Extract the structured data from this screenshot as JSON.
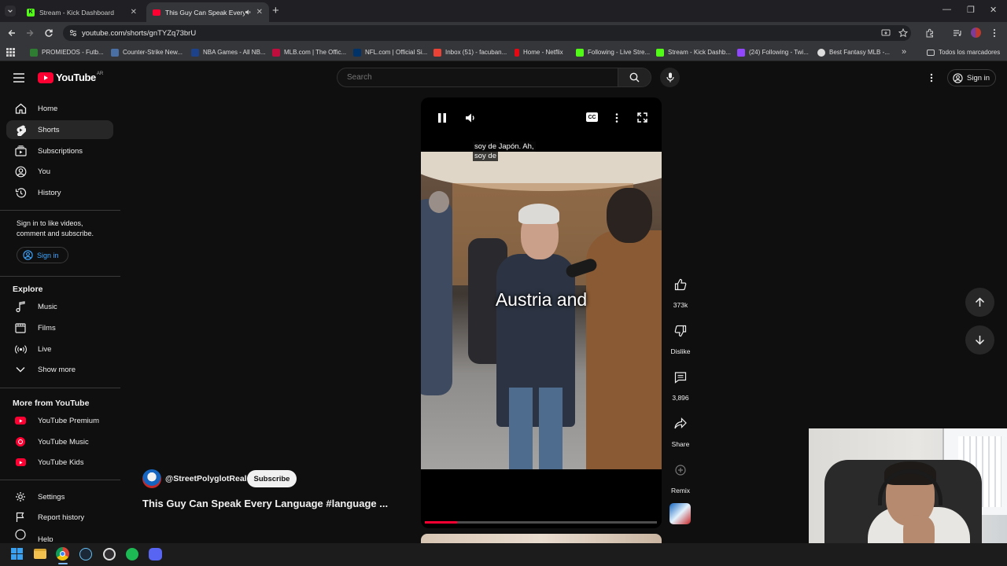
{
  "browser": {
    "tabs": [
      {
        "title": "Stream - Kick Dashboard",
        "favicon_color": "#53fc18",
        "favicon_letter": "K",
        "active": false
      },
      {
        "title": "This Guy Can Speak Every L",
        "favicon_color": "#ff0033",
        "active": true
      }
    ],
    "new_tab_label": "+",
    "url": "youtube.com/shorts/gnTYZq73brU",
    "bookmarks": [
      {
        "label": "PROMIEDOS - Futb...",
        "color": "#2e7d32"
      },
      {
        "label": "Counter-Strike New...",
        "color": "#4a6fa5"
      },
      {
        "label": "NBA Games - All NB...",
        "color": "#1d428a"
      },
      {
        "label": "MLB.com | The Offic...",
        "color": "#bf0d3e"
      },
      {
        "label": "NFL.com | Official Si...",
        "color": "#013369"
      },
      {
        "label": "Inbox (51) - facuban...",
        "color": "#ea4335"
      },
      {
        "label": "Home - Netflix",
        "color": "#e50914"
      },
      {
        "label": "Following - Live Stre...",
        "color": "#53fc18"
      },
      {
        "label": "Stream - Kick Dashb...",
        "color": "#53fc18"
      },
      {
        "label": "(24) Following - Twi...",
        "color": "#9146ff"
      },
      {
        "label": "Best Fantasy MLB -...",
        "color": "#dddddd"
      }
    ],
    "all_bookmarks": "Todos los marcadores",
    "window_controls": [
      "—",
      "❐",
      "✕"
    ]
  },
  "youtube": {
    "logo_text": "YouTube",
    "logo_region": "AR",
    "search_placeholder": "Search",
    "sign_in": "Sign in",
    "sidebar": {
      "main": [
        {
          "label": "Home",
          "icon": "home-icon"
        },
        {
          "label": "Shorts",
          "icon": "shorts-icon",
          "active": true
        },
        {
          "label": "Subscriptions",
          "icon": "subscriptions-icon"
        },
        {
          "label": "You",
          "icon": "you-icon"
        },
        {
          "label": "History",
          "icon": "history-icon"
        }
      ],
      "signin_prompt": "Sign in to like videos, comment and subscribe.",
      "signin_button": "Sign in",
      "explore_title": "Explore",
      "explore": [
        {
          "label": "Music",
          "icon": "music-icon"
        },
        {
          "label": "Films",
          "icon": "films-icon"
        },
        {
          "label": "Live",
          "icon": "live-icon"
        },
        {
          "label": "Show more",
          "icon": "chevron-down-icon"
        }
      ],
      "more_title": "More from YouTube",
      "more": [
        {
          "label": "YouTube Premium",
          "icon": "youtube-premium-icon"
        },
        {
          "label": "YouTube Music",
          "icon": "youtube-music-icon"
        },
        {
          "label": "YouTube Kids",
          "icon": "youtube-kids-icon"
        }
      ],
      "footer": [
        {
          "label": "Settings",
          "icon": "settings-icon"
        },
        {
          "label": "Report history",
          "icon": "flag-icon"
        },
        {
          "label": "Help",
          "icon": "help-icon"
        }
      ]
    },
    "short": {
      "subtitle_top": "soy de Japón.  Ah,",
      "subtitle_line2": "soy de",
      "caption": "Austria and",
      "channel": "@StreetPolyglotReal",
      "subscribe": "Subscribe",
      "title": "This Guy Can Speak Every Language #language ...",
      "progress": 0.14,
      "actions": [
        {
          "label": "373k",
          "icon": "like-icon"
        },
        {
          "label": "Dislike",
          "icon": "dislike-icon"
        },
        {
          "label": "3,896",
          "icon": "comment-icon"
        },
        {
          "label": "Share",
          "icon": "share-icon"
        },
        {
          "label": "Remix",
          "icon": "remix-icon"
        }
      ]
    }
  },
  "taskbar": {
    "apps": [
      "windows-start-icon",
      "file-explorer-icon",
      "chrome-icon",
      "steam-icon",
      "obs-icon",
      "spotify-icon",
      "discord-icon"
    ]
  }
}
